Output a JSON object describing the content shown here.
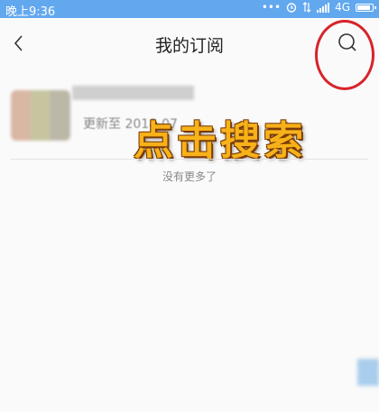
{
  "status_bar": {
    "time": "晚上9:36",
    "network": "4G",
    "dots": "•••"
  },
  "header": {
    "back_icon": "chevron-left-icon",
    "title": "我的订阅",
    "search_icon": "search-icon"
  },
  "subscriptions": [
    {
      "date": "更新至 2018-07"
    }
  ],
  "annotation": {
    "text": "点击搜索",
    "color": "#f7b21a"
  },
  "list_footer": "没有更多了",
  "colors": {
    "status_bar": "#62a8ef",
    "background": "#fafafa",
    "highlight": "#d8232a"
  }
}
